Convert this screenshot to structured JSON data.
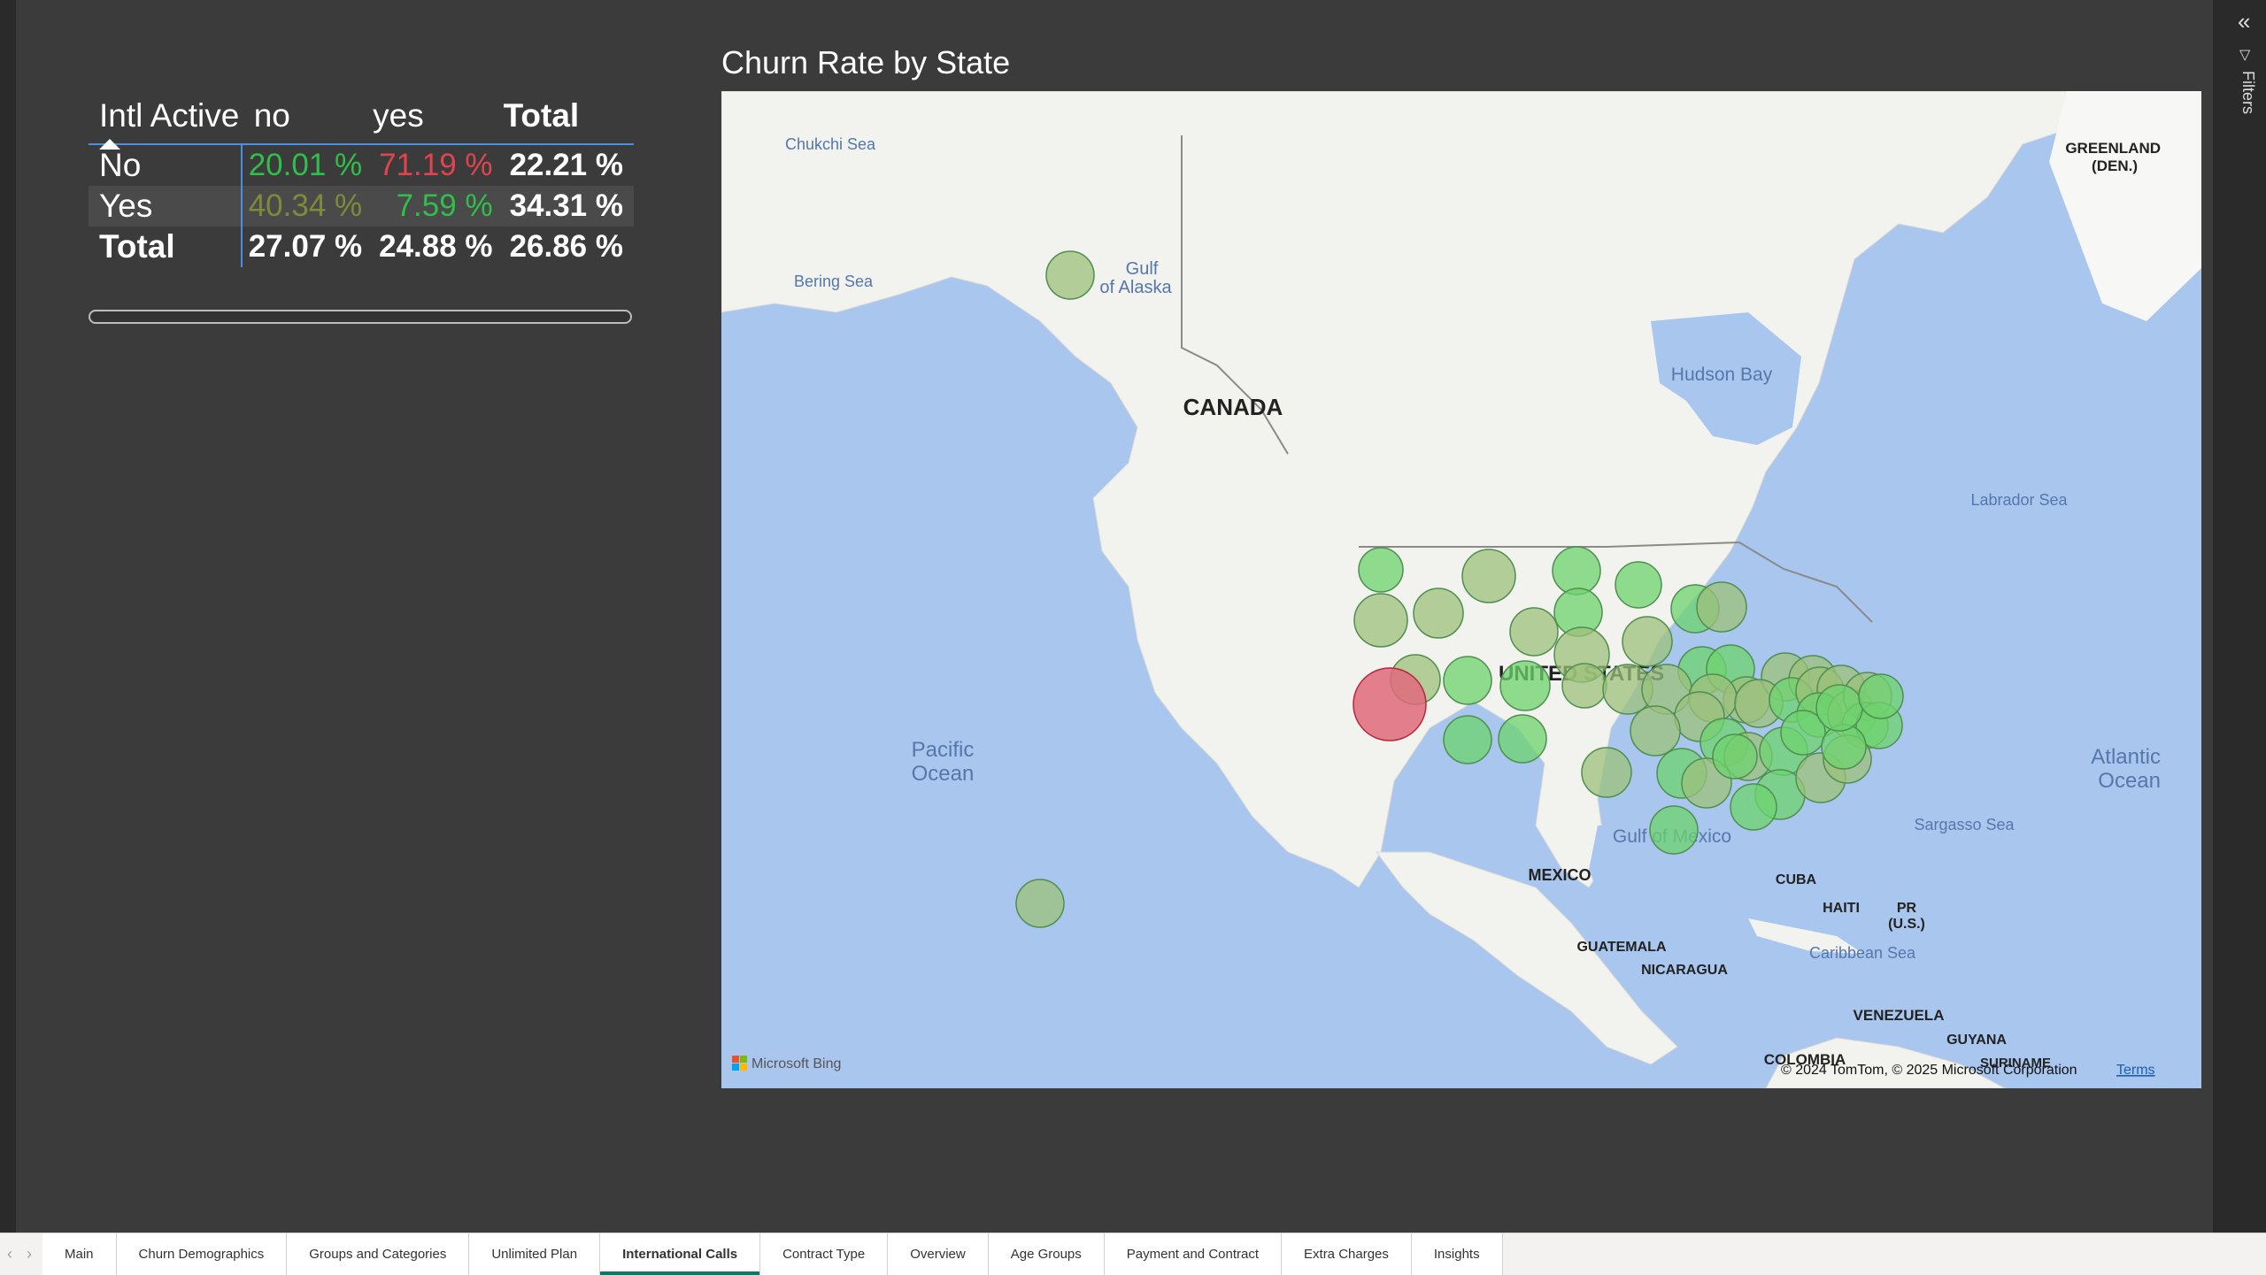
{
  "matrix": {
    "header": {
      "row_field": "Intl Active",
      "col_no": "no",
      "col_yes": "yes",
      "col_total": "Total"
    },
    "rows": [
      {
        "label": "No",
        "no": "20.01 %",
        "yes": "71.19 %",
        "total": "22.21 %",
        "no_color": "#2fbf4a",
        "yes_color": "#e0454f"
      },
      {
        "label": "Yes",
        "no": "40.34 %",
        "yes": "7.59 %",
        "total": "34.31 %",
        "no_color": "#7f8a3a",
        "yes_color": "#2fbf4a"
      }
    ],
    "total_row": {
      "label": "Total",
      "no": "27.07 %",
      "yes": "24.88 %",
      "total": "26.86 %"
    }
  },
  "map": {
    "title": "Churn Rate by State",
    "labels": {
      "chukchi": "Chukchi Sea",
      "bering": "Bering Sea",
      "gulf_alaska_1": "Gulf",
      "gulf_alaska_2": "of Alaska",
      "canada": "CANADA",
      "hudson": "Hudson Bay",
      "labrador": "Labrador Sea",
      "greenland_1": "GREENLAND",
      "greenland_2": "(DEN.)",
      "us": "UNITED STATES",
      "pacific_1": "Pacific",
      "pacific_2": "Ocean",
      "atlantic_1": "Atlantic",
      "atlantic_2": "Ocean",
      "sargasso": "Sargasso Sea",
      "gulf_mexico": "Gulf of Mexico",
      "mexico": "MEXICO",
      "cuba": "CUBA",
      "haiti": "HAITI",
      "pr_1": "PR",
      "pr_2": "(U.S.)",
      "guatemala": "GUATEMALA",
      "nicaragua": "NICARAGUA",
      "caribbean": "Caribbean Sea",
      "venezuela": "VENEZUELA",
      "guyana": "GUYANA",
      "colombia": "COLOMBIA",
      "suriname": "SURINAME"
    },
    "attribution": "© 2024 TomTom, © 2025 Microsoft Corporation",
    "terms": "Terms",
    "bing": "Microsoft Bing",
    "colors": {
      "low": "#6ed36e",
      "mid": "#9cc07a",
      "high": "#e06a7a",
      "water": "#a9c6ef",
      "land": "#f2f2ef"
    }
  },
  "filters_label": "Filters",
  "tabs": [
    "Main",
    "Churn Demographics",
    "Groups and Categories",
    "Unlimited Plan",
    "International Calls",
    "Contract Type",
    "Overview",
    "Age Groups",
    "Payment and Contract",
    "Extra Charges",
    "Insights"
  ],
  "active_tab": "International Calls"
}
